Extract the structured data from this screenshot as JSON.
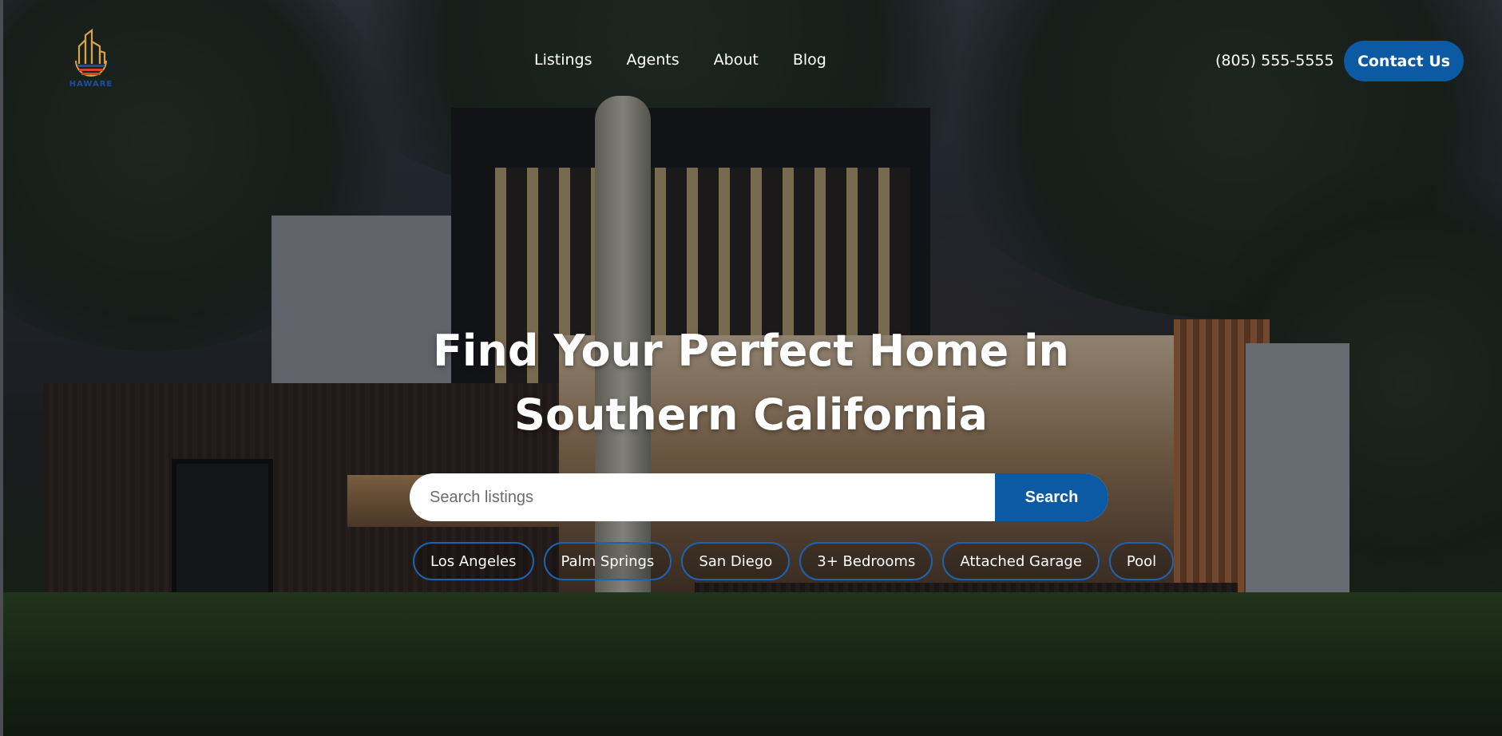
{
  "brand": {
    "logo_text": "HAWARE"
  },
  "nav": {
    "items": [
      "Listings",
      "Agents",
      "About",
      "Blog"
    ]
  },
  "header": {
    "phone": "(805) 555-5555",
    "contact_label": "Contact Us"
  },
  "hero": {
    "headline_line1": "Find Your Perfect Home in",
    "headline_line2": "Southern California",
    "search_placeholder": "Search listings",
    "search_button": "Search",
    "chips": [
      "Los Angeles",
      "Palm Springs",
      "San Diego",
      "3+ Bedrooms",
      "Attached Garage",
      "Pool"
    ]
  },
  "colors": {
    "accent": "#0b5aa3",
    "chip_border": "#1e63b0",
    "logo_gold": "#d8a24a",
    "logo_blue": "#1f4ea0",
    "logo_red": "#d9432c"
  }
}
